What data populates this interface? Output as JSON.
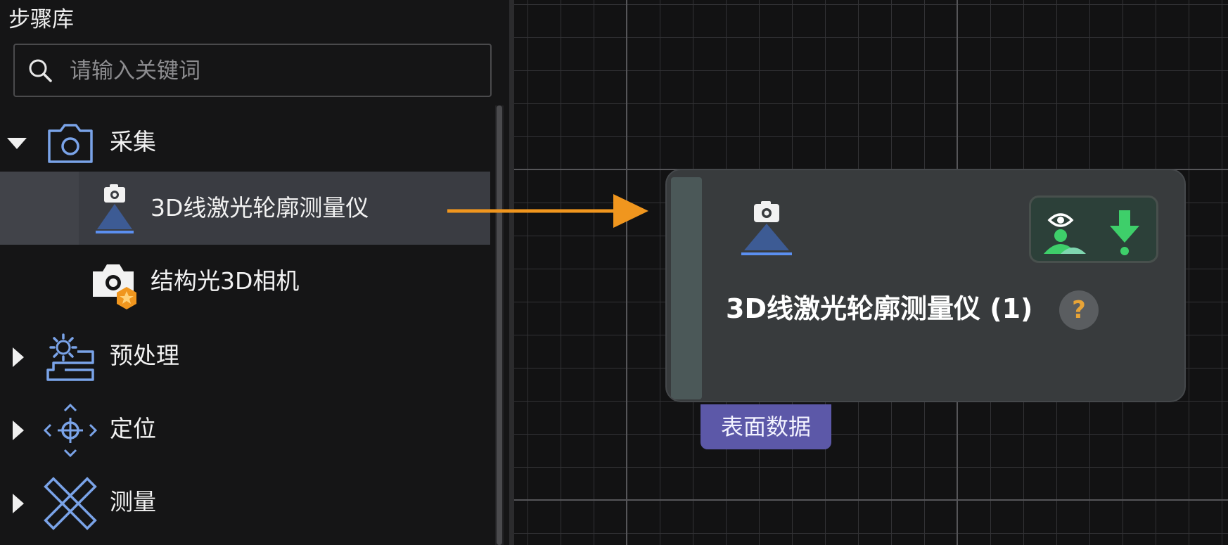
{
  "sidebar": {
    "title": "步骤库",
    "search": {
      "placeholder": "请输入关键词",
      "value": ""
    },
    "categories": [
      {
        "label": "采集",
        "icon": "camera-icon",
        "expanded": true,
        "items": [
          {
            "label": "3D线激光轮廓测量仪",
            "icon": "laser-profiler-icon",
            "selected": true
          },
          {
            "label": "结构光3D相机",
            "icon": "structured-light-camera-icon",
            "selected": false
          }
        ]
      },
      {
        "label": "预处理",
        "icon": "preprocess-icon",
        "expanded": false
      },
      {
        "label": "定位",
        "icon": "locate-icon",
        "expanded": false
      },
      {
        "label": "测量",
        "icon": "measure-icon",
        "expanded": false
      }
    ]
  },
  "canvas": {
    "node": {
      "title": "3D线激光轮廓测量仪 (1)",
      "icon": "laser-profiler-icon",
      "badges": [
        "view-icon",
        "download-icon"
      ],
      "help_label": "?",
      "output_port": "表面数据"
    }
  },
  "colors": {
    "arrow": "#f0961e",
    "accent_blue": "#7aa3e8",
    "port": "#5c58a8",
    "badge_green": "#3ecf6a",
    "help_question": "#e8a437"
  }
}
